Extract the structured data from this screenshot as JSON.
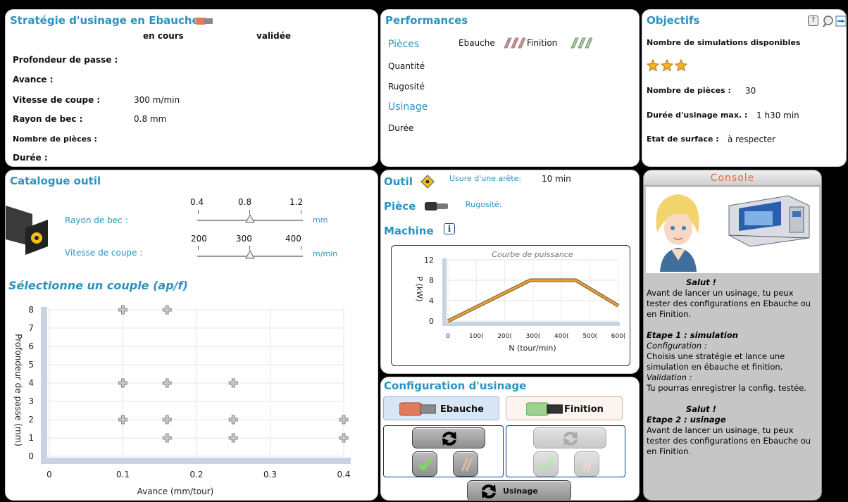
{
  "strategie": {
    "title": "Stratégie d'usinage en Ebauche",
    "col_en_cours": "en cours",
    "col_validee": "validée",
    "rows": [
      {
        "label": "Profondeur de passe :",
        "value": ""
      },
      {
        "label": "Avance :",
        "value": ""
      },
      {
        "label": "Vitesse de coupe :",
        "value": "300 m/min"
      },
      {
        "label": "Rayon de bec :",
        "value": "0.8 mm"
      },
      {
        "label": "Nombre de pièces :",
        "value": ""
      },
      {
        "label": "Durée :",
        "value": ""
      }
    ]
  },
  "performances": {
    "title": "Performances",
    "pieces_label": "Pièces",
    "ebauche_label": "Ebauche",
    "finition_label": "Finition",
    "quantite_label": "Quantité",
    "rugosite_label": "Rugosité",
    "usinage_label": "Usinage",
    "duree_label": "Durée"
  },
  "objectifs": {
    "title": "Objectifs",
    "simulations_label": "Nombre de simulations disponibles",
    "stars": 3,
    "nb_pieces_label": "Nombre de pièces :",
    "nb_pieces_value": "30",
    "duree_label": "Durée d'usinage max. :",
    "duree_value": "1 h30 min",
    "etat_label": "Etat de surface :",
    "etat_value": "à respecter",
    "help_icon": "?",
    "zoom_icon": "magnifier-icon",
    "exit_icon": "arrow-exit-icon"
  },
  "catalogue": {
    "title": "Catalogue outil",
    "rayon_label": "Rayon de bec :",
    "rayon_ticks": [
      "0.4",
      "0.8",
      "1.2"
    ],
    "rayon_unit": "mm",
    "rayon_value": 0.8,
    "vitesse_label": "Vitesse de coupe :",
    "vitesse_ticks": [
      "200",
      "300",
      "400"
    ],
    "vitesse_unit": "m/min",
    "vitesse_value": 300
  },
  "couple": {
    "title": "Sélectionne un couple (ap/f)",
    "xlabel": "Avance (mm/tour)",
    "ylabel": "Profondeur de passe (mm)"
  },
  "outil": {
    "outil_label": "Outil",
    "usure_label": "Usure d'une arête:",
    "usure_value": "10 min",
    "piece_label": "Pièce",
    "rugosite_label": "Rugosité:",
    "machine_label": "Machine",
    "info_icon": "i"
  },
  "config": {
    "title": "Configuration d'usinage",
    "ebauche_label": "Ebauche",
    "finition_label": "Finition",
    "usinage_label": "Usinage"
  },
  "console": {
    "title": "Console",
    "lines": [
      {
        "text": "Salut !",
        "style": "bi-center"
      },
      {
        "text": "Avant de lancer un usinage, tu peux tester des configurations en Ebauche ou en Finition.",
        "style": "n"
      },
      {
        "text": "",
        "style": "n"
      },
      {
        "text": "Etape 1 : simulation",
        "style": "bi"
      },
      {
        "text": "Configuration :",
        "style": "i"
      },
      {
        "text": "Choisis une stratégie et lance une simulation en ébauche et finition.",
        "style": "n"
      },
      {
        "text": "Validation :",
        "style": "i"
      },
      {
        "text": "Tu pourras enregistrer la config. testée.",
        "style": "n"
      },
      {
        "text": "",
        "style": "n"
      },
      {
        "text": "Salut !",
        "style": "bi-center"
      },
      {
        "text": "Etape 2 : usinage",
        "style": "bi"
      },
      {
        "text": "Avant de lancer un usinage, tu peux tester des configurations en Ebauche ou en Finition.",
        "style": "n"
      }
    ]
  },
  "chart_data": [
    {
      "type": "scatter",
      "title": "Sélectionne un couple (ap/f)",
      "xlabel": "Avance (mm/tour)",
      "ylabel": "Profondeur de passe (mm)",
      "xlim": [
        0,
        0.4
      ],
      "ylim": [
        0,
        8
      ],
      "x_ticks": [
        "0",
        "0.1",
        "0.2",
        "0.3",
        "0.4"
      ],
      "y_ticks": [
        "0",
        "1",
        "2",
        "3",
        "4",
        "5",
        "6",
        "7",
        "8"
      ],
      "grid": true,
      "points": [
        {
          "x": 0.1,
          "y": 8
        },
        {
          "x": 0.16,
          "y": 8
        },
        {
          "x": 0.1,
          "y": 4
        },
        {
          "x": 0.16,
          "y": 4
        },
        {
          "x": 0.25,
          "y": 4
        },
        {
          "x": 0.1,
          "y": 2
        },
        {
          "x": 0.16,
          "y": 2
        },
        {
          "x": 0.25,
          "y": 2
        },
        {
          "x": 0.4,
          "y": 2
        },
        {
          "x": 0.16,
          "y": 1
        },
        {
          "x": 0.25,
          "y": 1
        },
        {
          "x": 0.4,
          "y": 1
        }
      ]
    },
    {
      "type": "line",
      "title": "Courbe de puissance",
      "xlabel": "N (tour/min)",
      "ylabel": "P (kW)",
      "xlim": [
        0,
        6000
      ],
      "ylim": [
        0,
        12
      ],
      "x_ticks": [
        "0",
        "100(",
        "200(",
        "300(",
        "400(",
        "500(",
        "600("
      ],
      "y_ticks": [
        "0",
        "4",
        "8",
        "12"
      ],
      "series": [
        {
          "x": [
            0,
            2900,
            4500,
            6000
          ],
          "y": [
            0,
            8,
            8,
            3
          ]
        }
      ]
    }
  ]
}
